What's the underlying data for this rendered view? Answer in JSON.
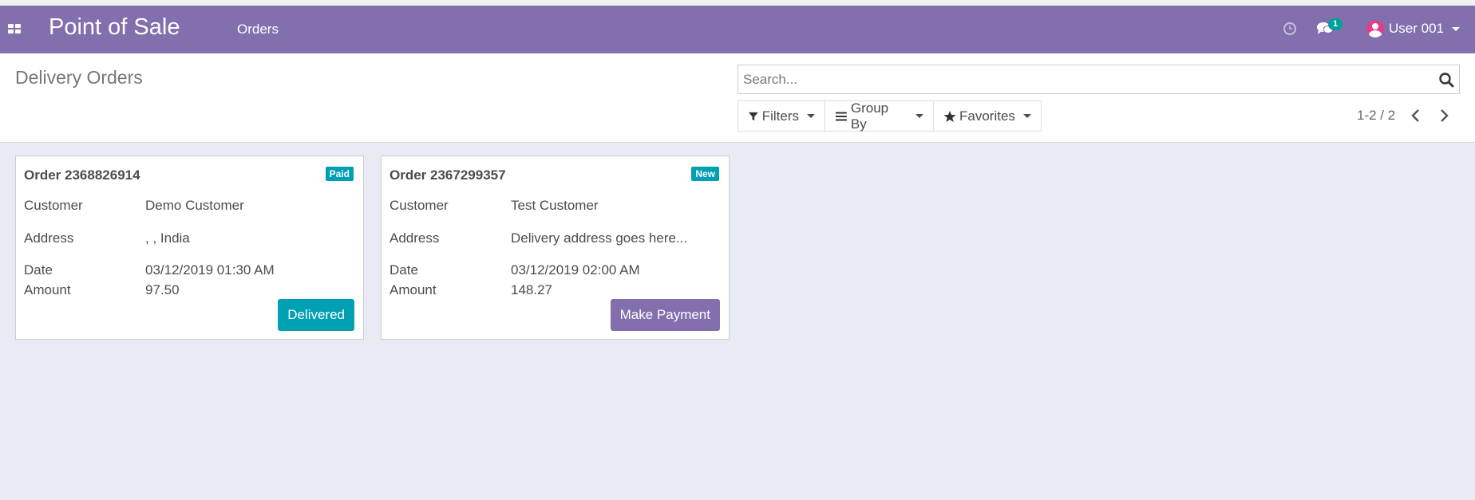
{
  "navbar": {
    "app_title": "Point of Sale",
    "menu_orders": "Orders",
    "chat_count": "1",
    "user_name": "User 001"
  },
  "control_panel": {
    "title": "Delivery Orders",
    "search_placeholder": "Search...",
    "filters_label": "Filters",
    "group_by_label": "Group By",
    "favorites_label": "Favorites",
    "pager": "1-2 / 2"
  },
  "labels": {
    "customer": "Customer",
    "address": "Address",
    "date": "Date",
    "amount": "Amount"
  },
  "orders": [
    {
      "title": "Order 2368826914",
      "status": "Paid",
      "customer": "Demo Customer",
      "address": ", , India",
      "date": "03/12/2019 01:30 AM",
      "amount": "97.50",
      "action": "Delivered",
      "action_color": "#00a0b4"
    },
    {
      "title": "Order 2367299357",
      "status": "New",
      "customer": "Test Customer",
      "address": "Delivery address goes here...",
      "date": "03/12/2019 02:00 AM",
      "amount": "148.27",
      "action": "Make Payment",
      "action_color": "#836fae"
    }
  ],
  "colors": {
    "navbar": "#836fae",
    "badge": "#00a0b4",
    "chat_badge": "#00a09d",
    "background": "#e9ebf4"
  }
}
